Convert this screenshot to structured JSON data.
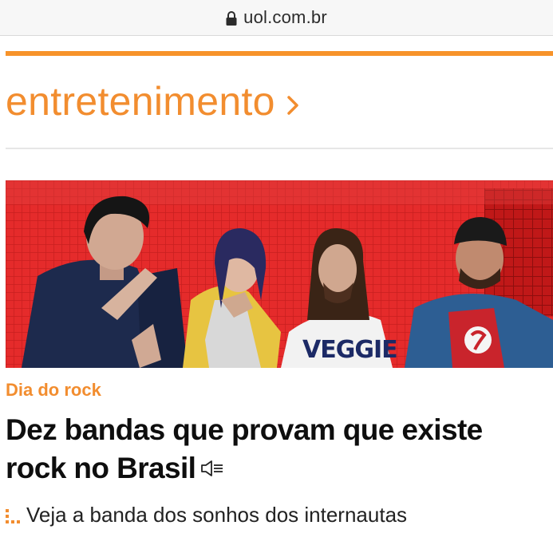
{
  "browser": {
    "url": "uol.com.br",
    "lock_icon": "lock-icon"
  },
  "section": {
    "title": "entretenimento",
    "chevron_icon": "chevron-right-icon",
    "accent_color": "#f28d2f"
  },
  "hero": {
    "image": "band-photo",
    "shirt_text": "VEGGIE",
    "background_color": "#e82a2a"
  },
  "article": {
    "kicker": "Dia do rock",
    "headline": "Dez bandas que provam que existe rock no Brasil",
    "audio_icon": "speaker-icon"
  },
  "related": {
    "icon": "dots-icon",
    "label": "Veja a banda dos sonhos dos internautas"
  }
}
